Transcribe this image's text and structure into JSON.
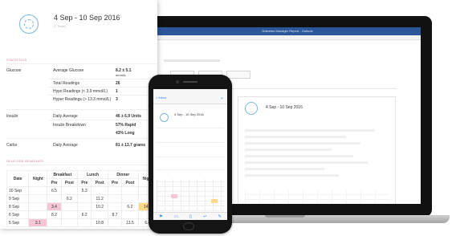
{
  "laptop": {
    "window_title": "Diabetes Manager Report - Outlook",
    "report_date": "4 Sep - 10 Sep 2016"
  },
  "report": {
    "date_range": "4 Sep - 10 Sep 2016",
    "sub": "(7 Days)",
    "section_statistics": "STATISTICS",
    "glucose_label": "Glucose",
    "average_glucose_label": "Average Glucose",
    "average_glucose_value": "8.2 ± 5.1",
    "average_glucose_unit": "mmol/L",
    "total_readings_label": "Total Readings",
    "total_readings_value": "26",
    "hypo_label": "Hypo Readings (< 3.9 mmol/L)",
    "hypo_value": "1",
    "hyper_label": "Hyper Readings (> 13.3 mmol/L)",
    "hyper_value": "3",
    "insulin_label": "Insulin",
    "daily_average_label": "Daily Average",
    "insulin_daily_value": "46 ± 6.9 Units",
    "insulin_breakdown_label": "Insulin Breakdown",
    "rapid_value": "57% Rapid",
    "long_value": "43% Long",
    "carbs_label": "Carbs",
    "carbs_daily_label": "Daily Average",
    "carbs_daily_value": "81 ± 13.7 grams",
    "section_glucose": "GLUCOSE READINGS",
    "table": {
      "headers_top": [
        "Date",
        "Night",
        "Breakfast",
        "Lunch",
        "Dinner",
        "Night"
      ],
      "headers_sub": [
        "Pre",
        "Post",
        "Pre",
        "Post",
        "Pre",
        "Post"
      ],
      "rows": [
        {
          "date": "10 Sep",
          "cells": [
            "",
            "",
            "6.5",
            "",
            "5.3",
            "",
            "",
            "",
            ""
          ]
        },
        {
          "date": "9 Sep",
          "cells": [
            "",
            "",
            "",
            "6.2",
            "",
            "11.2",
            "",
            "",
            ""
          ]
        },
        {
          "date": "8 Sep",
          "cells": [
            "",
            "",
            "3.4",
            "",
            "",
            "10.2",
            "",
            "6.2",
            "14.4"
          ]
        },
        {
          "date": "6 Sep",
          "cells": [
            "",
            "",
            "8.2",
            "",
            "6.2",
            "",
            "8.7",
            "",
            ""
          ]
        },
        {
          "date": "5 Sep",
          "cells": [
            "3.1",
            "",
            "",
            "",
            "",
            "10.8",
            "",
            "13.5",
            "6.4"
          ]
        }
      ]
    }
  },
  "phone": {
    "back_label": "< Inbox",
    "date_range": "4 Sep - 10 Sep 2016"
  }
}
